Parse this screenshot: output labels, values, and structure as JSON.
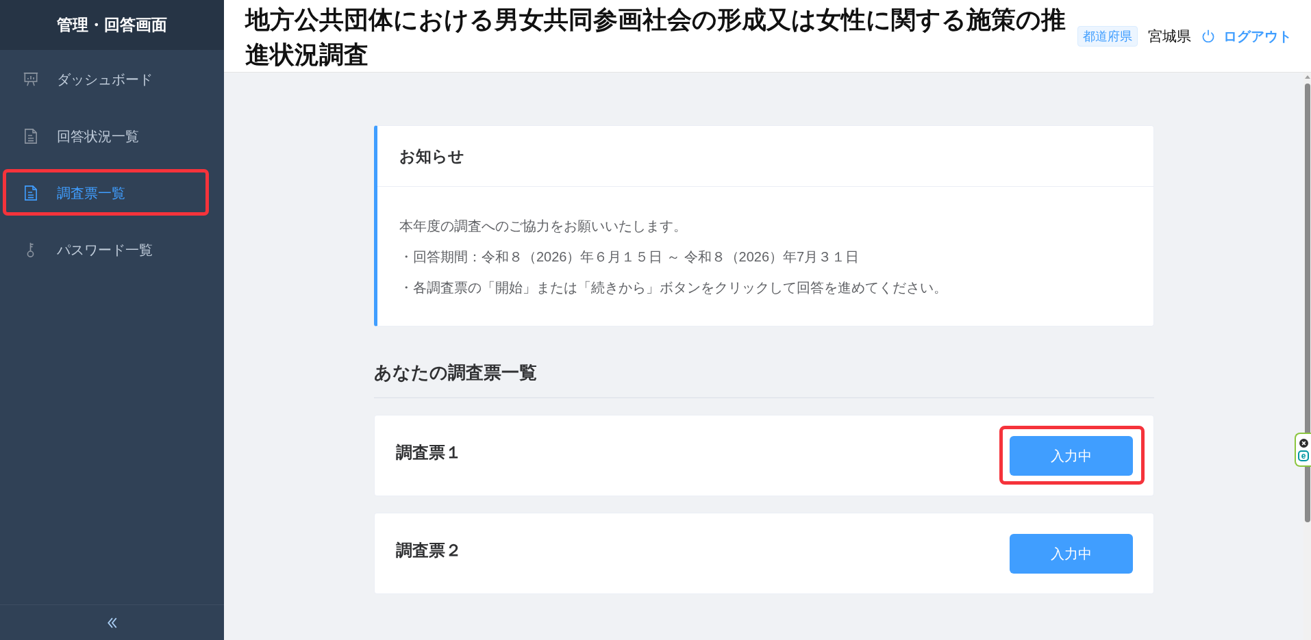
{
  "sidebar": {
    "title": "管理・回答画面",
    "items": [
      {
        "label": "ダッシュボード",
        "kind": "chart",
        "selected": false,
        "highlighted": false
      },
      {
        "label": "回答状況一覧",
        "kind": "document",
        "selected": false,
        "highlighted": false
      },
      {
        "label": "調査票一覧",
        "kind": "document",
        "selected": true,
        "highlighted": true
      },
      {
        "label": "パスワード一覧",
        "kind": "key",
        "selected": false,
        "highlighted": false
      }
    ]
  },
  "header": {
    "title": "地方公共団体における男女共同参画社会の形成又は女性に関する施策の推進状況調査",
    "role_badge": "都道府県",
    "user_name": "宮城県",
    "logout_link": "ログアウト"
  },
  "notice": {
    "title": "お知らせ",
    "lines": [
      "本年度の調査へのご協力をお願いいたします。",
      "・回答期間：令和８（2026）年６月１５日 ～ 令和８（2026）年7月３１日",
      "・各調査票の「開始」または「続きから」ボタンをクリックして回答を進めてください。"
    ]
  },
  "survey_section": {
    "title": "あなたの調査票一覧",
    "surveys": [
      {
        "name": "調査票１",
        "button": "入力中",
        "highlighted": true
      },
      {
        "name": "調査票２",
        "button": "入力中",
        "highlighted": false
      }
    ]
  },
  "extension_tab": {
    "logo": "e"
  }
}
